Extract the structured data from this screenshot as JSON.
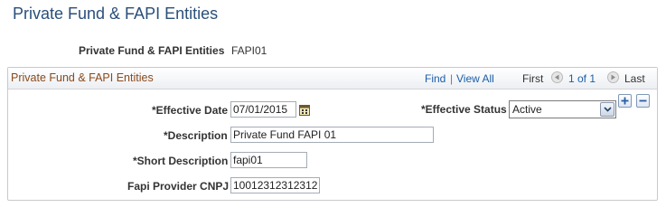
{
  "page": {
    "title": "Private Fund & FAPI Entities"
  },
  "key": {
    "label": "Private Fund & FAPI Entities",
    "value": "FAPI01"
  },
  "grid": {
    "title": "Private Fund & FAPI Entities",
    "nav": {
      "find": "Find",
      "separator": "|",
      "view_all": "View All",
      "first": "First",
      "count": "1 of 1",
      "last": "Last"
    }
  },
  "fields": {
    "effective_date": {
      "label": "*Effective Date",
      "value": "07/01/2015"
    },
    "effective_status": {
      "label": "*Effective Status",
      "value": "Active"
    },
    "description": {
      "label": "*Description",
      "value": "Private Fund FAPI 01"
    },
    "short_description": {
      "label": "*Short Description",
      "value": "fapi01"
    },
    "provider_cnpj": {
      "label": "Fapi Provider CNPJ",
      "value": "10012312312312"
    }
  },
  "icons": {
    "calendar": "calendar-icon",
    "prev": "left-arrow-icon",
    "next": "right-arrow-icon",
    "add": "plus-icon",
    "remove": "minus-icon",
    "dropdown": "chevron-down-icon"
  },
  "colors": {
    "title": "#2b4f7a",
    "grid_title": "#8a4a1c",
    "link": "#1b5ea8"
  }
}
